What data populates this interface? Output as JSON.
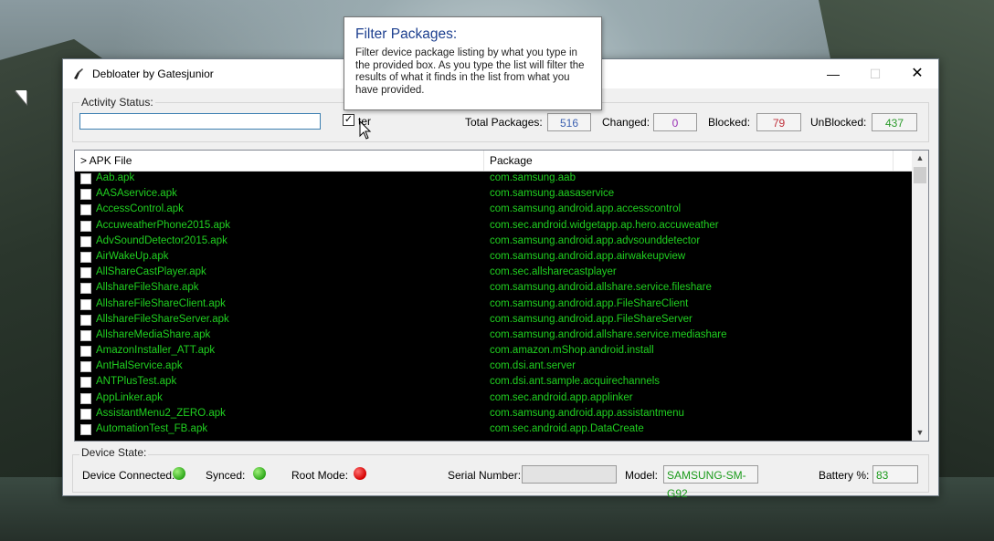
{
  "window": {
    "title": "Debloater by Gatesjunior",
    "min_glyph": "—",
    "max_glyph": "☐",
    "close_glyph": "✕"
  },
  "activity": {
    "group_label": "Activity Status:",
    "filter_value": "",
    "filter_checked": true,
    "filter_label": "ter"
  },
  "stats": {
    "total_label": "Total Packages:",
    "total_value": "516",
    "changed_label": "Changed:",
    "changed_value": "0",
    "blocked_label": "Blocked:",
    "blocked_value": "79",
    "unblocked_label": "UnBlocked:",
    "unblocked_value": "437"
  },
  "list": {
    "col_apk": "> APK File",
    "col_package": "Package",
    "rows": [
      {
        "apk": "Aab.apk",
        "package": "com.samsung.aab"
      },
      {
        "apk": "AASAservice.apk",
        "package": "com.samsung.aasaservice"
      },
      {
        "apk": "AccessControl.apk",
        "package": "com.samsung.android.app.accesscontrol"
      },
      {
        "apk": "AccuweatherPhone2015.apk",
        "package": "com.sec.android.widgetapp.ap.hero.accuweather"
      },
      {
        "apk": "AdvSoundDetector2015.apk",
        "package": "com.samsung.android.app.advsounddetector"
      },
      {
        "apk": "AirWakeUp.apk",
        "package": "com.samsung.android.app.airwakeupview"
      },
      {
        "apk": "AllShareCastPlayer.apk",
        "package": "com.sec.allsharecastplayer"
      },
      {
        "apk": "AllshareFileShare.apk",
        "package": "com.samsung.android.allshare.service.fileshare"
      },
      {
        "apk": "AllshareFileShareClient.apk",
        "package": "com.samsung.android.app.FileShareClient"
      },
      {
        "apk": "AllshareFileShareServer.apk",
        "package": "com.samsung.android.app.FileShareServer"
      },
      {
        "apk": "AllshareMediaShare.apk",
        "package": "com.samsung.android.allshare.service.mediashare"
      },
      {
        "apk": "AmazonInstaller_ATT.apk",
        "package": "com.amazon.mShop.android.install"
      },
      {
        "apk": "AntHalService.apk",
        "package": "com.dsi.ant.server"
      },
      {
        "apk": "ANTPlusTest.apk",
        "package": "com.dsi.ant.sample.acquirechannels"
      },
      {
        "apk": "AppLinker.apk",
        "package": "com.sec.android.app.applinker"
      },
      {
        "apk": "AssistantMenu2_ZERO.apk",
        "package": "com.samsung.android.app.assistantmenu"
      },
      {
        "apk": "AutomationTest_FB.apk",
        "package": "com.sec.android.app.DataCreate"
      }
    ]
  },
  "device": {
    "group_label": "Device State:",
    "connected_label": "Device Connected:",
    "synced_label": "Synced:",
    "root_label": "Root Mode:",
    "serial_label": "Serial Number:",
    "serial_value": "",
    "model_label": "Model:",
    "model_value": "SAMSUNG-SM-G92",
    "battery_label": "Battery %:",
    "battery_value": "83"
  },
  "tooltip": {
    "title": "Filter Packages:",
    "body": "Filter device package listing by what you type in the provided box.  As you type the list will filter the results of what it finds in the list from what you have provided."
  },
  "colors": {
    "total": "#3a5fb0",
    "changed": "#9a2fb5",
    "blocked": "#c0303a",
    "unblocked": "#2a9a2a",
    "list_text": "#20d020"
  }
}
